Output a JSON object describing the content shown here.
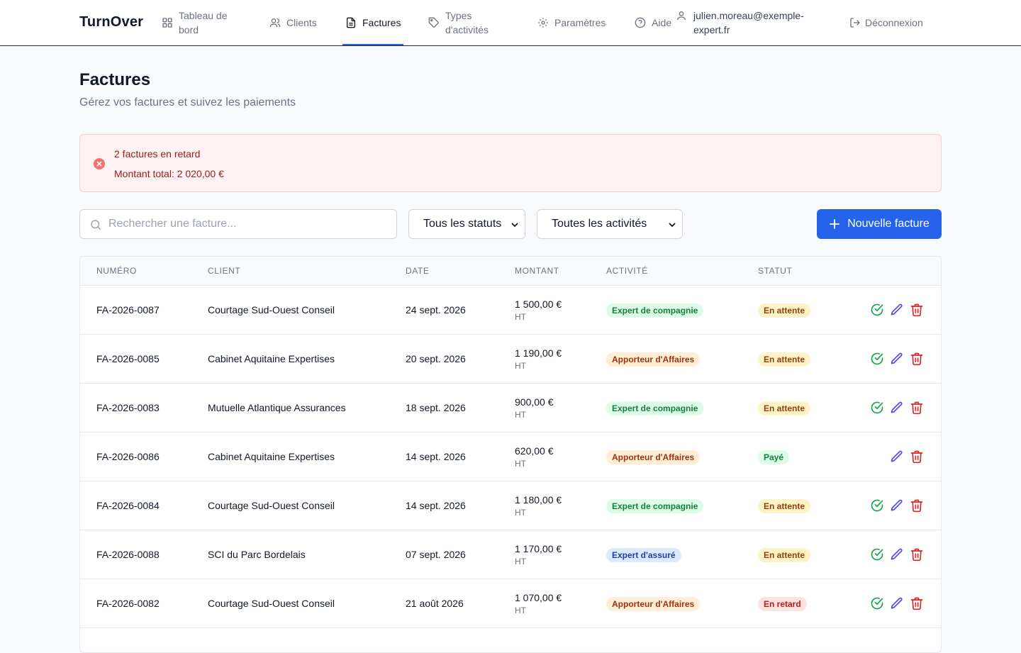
{
  "header": {
    "brand": "TurnOver",
    "nav": [
      {
        "label": "Tableau de bord",
        "icon": "dashboard-icon"
      },
      {
        "label": "Clients",
        "icon": "users-icon"
      },
      {
        "label": "Factures",
        "icon": "document-icon",
        "active": true
      },
      {
        "label": "Types d'activités",
        "icon": "tag-icon"
      },
      {
        "label": "Paramètres",
        "icon": "gear-icon"
      },
      {
        "label": "Aide",
        "icon": "help-icon"
      }
    ],
    "user_email": "julien.moreau@exemple-expert.fr",
    "logout_label": "Déconnexion"
  },
  "page": {
    "title": "Factures",
    "subtitle": "Gérez vos factures et suivez les paiements"
  },
  "alert": {
    "line1": "2 factures en retard",
    "line2": "Montant total: 2 020,00 €"
  },
  "filters": {
    "search_placeholder": "Rechercher une facture...",
    "status_select": "Tous les statuts",
    "activity_select": "Toutes les activités",
    "new_button": "Nouvelle facture"
  },
  "table": {
    "columns": [
      "Numéro",
      "Client",
      "Date",
      "Montant",
      "Activité",
      "Statut"
    ],
    "rows": [
      {
        "numero": "FA-2026-0087",
        "client": "Courtage Sud-Ouest Conseil",
        "date": "24 sept. 2026",
        "montant": "1 500,00 €",
        "ht": "HT",
        "activite": "Expert de compagnie",
        "statut": "En attente"
      },
      {
        "numero": "FA-2026-0085",
        "client": "Cabinet Aquitaine Expertises",
        "date": "20 sept. 2026",
        "montant": "1 190,00 €",
        "ht": "HT",
        "activite": "Apporteur d'Affaires",
        "statut": "En attente"
      },
      {
        "numero": "FA-2026-0083",
        "client": "Mutuelle Atlantique Assurances",
        "date": "18 sept. 2026",
        "montant": "900,00 €",
        "ht": "HT",
        "activite": "Expert de compagnie",
        "statut": "En attente"
      },
      {
        "numero": "FA-2026-0086",
        "client": "Cabinet Aquitaine Expertises",
        "date": "14 sept. 2026",
        "montant": "620,00 €",
        "ht": "HT",
        "activite": "Apporteur d'Affaires",
        "statut": "Payé"
      },
      {
        "numero": "FA-2026-0084",
        "client": "Courtage Sud-Ouest Conseil",
        "date": "14 sept. 2026",
        "montant": "1 180,00 €",
        "ht": "HT",
        "activite": "Expert de compagnie",
        "statut": "En attente"
      },
      {
        "numero": "FA-2026-0088",
        "client": "SCI du Parc Bordelais",
        "date": "07 sept. 2026",
        "montant": "1 170,00 €",
        "ht": "HT",
        "activite": "Expert d'assuré",
        "statut": "En attente"
      },
      {
        "numero": "FA-2026-0082",
        "client": "Courtage Sud-Ouest Conseil",
        "date": "21 août 2026",
        "montant": "1 070,00 €",
        "ht": "HT",
        "activite": "Apporteur d'Affaires",
        "statut": "En retard"
      }
    ]
  },
  "colors": {
    "accent": "#2563eb",
    "activity": {
      "Expert de compagnie": {
        "bg": "#dcfce7",
        "fg": "#15803d"
      },
      "Apporteur d'Affaires": {
        "bg": "#ffedd5",
        "fg": "#9a3412"
      },
      "Expert d'assuré": {
        "bg": "#dbeafe",
        "fg": "#1e40af"
      }
    },
    "status": {
      "En attente": {
        "bg": "#fef3c7",
        "fg": "#92400e"
      },
      "Payé": {
        "bg": "#dcfce7",
        "fg": "#15803d"
      },
      "En retard": {
        "bg": "#fee2e2",
        "fg": "#b91c1c"
      }
    }
  }
}
